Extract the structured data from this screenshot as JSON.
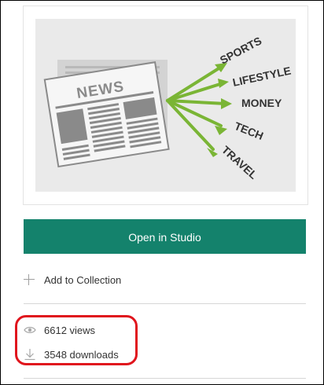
{
  "thumbnail": {
    "newspaper_title": "NEWS",
    "categories": [
      "SPORTS",
      "LIFESTYLE",
      "MONEY",
      "TECH",
      "TRAVEL"
    ],
    "arrow_color": "#7ab535",
    "paper_color": "#f6f6f6",
    "ink_color": "#8a8a8a"
  },
  "actions": {
    "open_label": "Open in Studio",
    "open_color": "#14826c",
    "add_collection_label": "Add to Collection"
  },
  "stats": {
    "views": "6612 views",
    "downloads": "3548 downloads"
  },
  "highlight_color": "#e0151d"
}
